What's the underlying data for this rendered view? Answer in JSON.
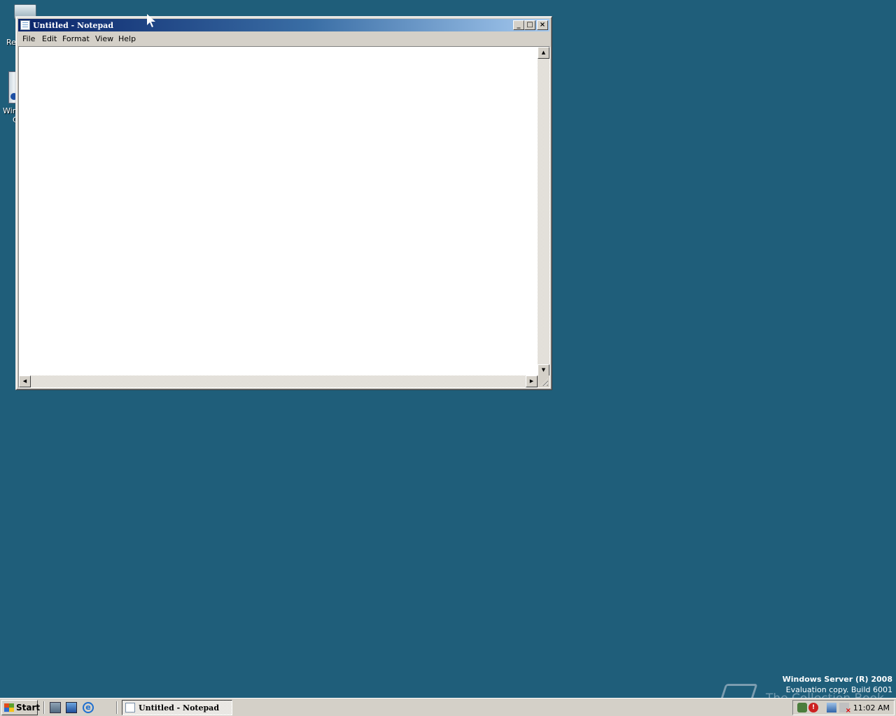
{
  "desktop": {
    "icons": [
      {
        "label_fragment": "Re"
      },
      {
        "label_line1_fragment": "Win",
        "label_line2_fragment": "C"
      }
    ]
  },
  "window": {
    "title": "Untitled - Notepad",
    "controls": {
      "minimize": "_",
      "maximize": "□",
      "close": "×"
    },
    "menu": [
      "File",
      "Edit",
      "Format",
      "View",
      "Help"
    ],
    "text": ""
  },
  "watermark": {
    "line1": "Windows Server (R) 2008",
    "line2": "Evaluation copy. Build 6001",
    "overlay": "The Collection Book"
  },
  "taskbar": {
    "start_label": "Start",
    "task_button_label": "Untitled - Notepad",
    "clock": "11:02 AM",
    "update_badge": "!"
  }
}
